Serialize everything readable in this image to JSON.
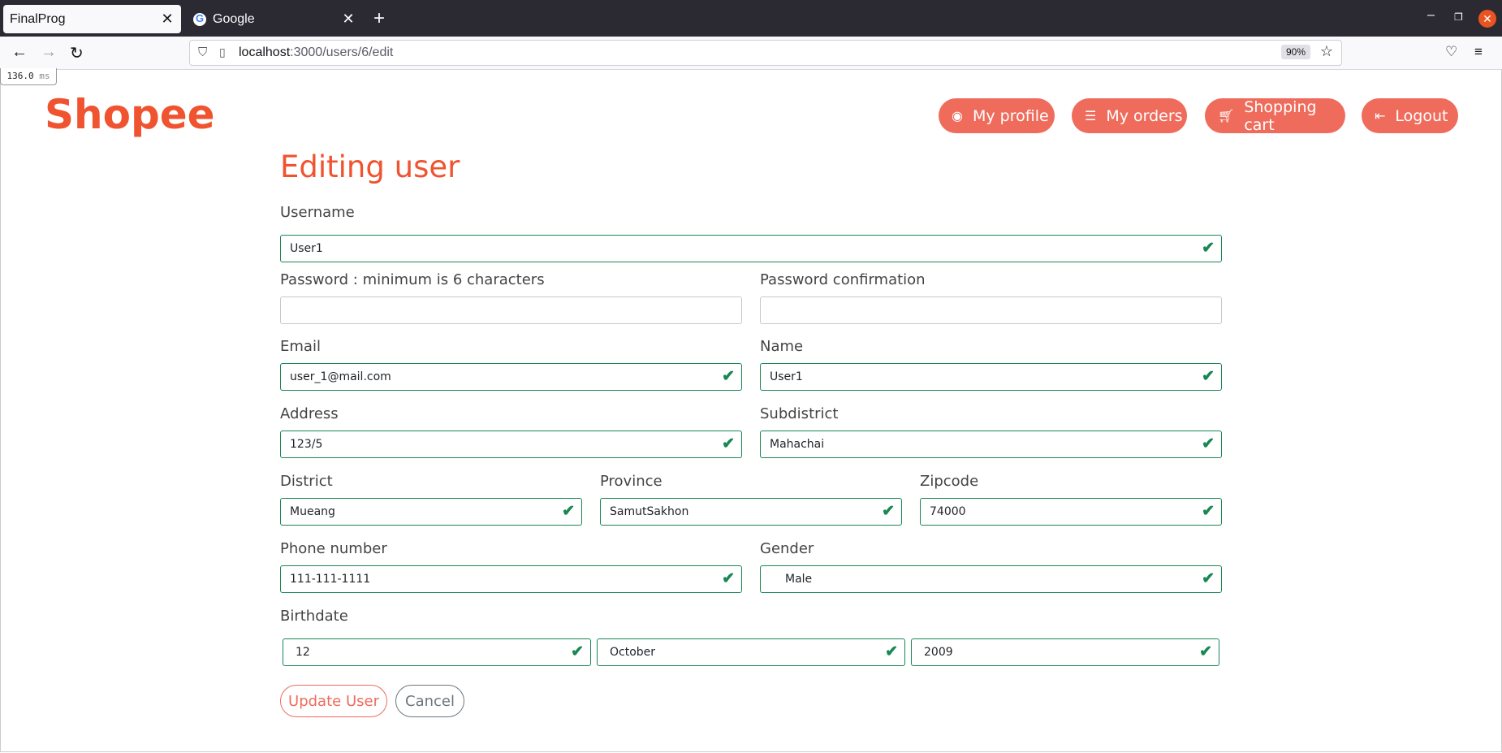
{
  "browser": {
    "tabs": [
      {
        "title": "FinalProg",
        "active": true
      },
      {
        "title": "Google",
        "active": false
      }
    ],
    "url_host": "localhost",
    "url_path": ":3000/users/6/edit",
    "zoom": "90%",
    "timing_value": "136.0",
    "timing_unit": "ms"
  },
  "header": {
    "brand": "Shopee",
    "nav": {
      "profile": "My profile",
      "orders": "My orders",
      "cart": "Shopping cart",
      "logout": "Logout"
    }
  },
  "form": {
    "title": "Editing user",
    "username_label": "Username",
    "username": "User1",
    "password_label": "Password : minimum is 6 characters",
    "password": "",
    "password_confirmation_label": "Password confirmation",
    "password_confirmation": "",
    "email_label": "Email",
    "email": "user_1@mail.com",
    "name_label": "Name",
    "name": "User1",
    "address_label": "Address",
    "address": "123/5",
    "subdistrict_label": "Subdistrict",
    "subdistrict": "Mahachai",
    "district_label": "District",
    "district": "Mueang",
    "province_label": "Province",
    "province": "SamutSakhon",
    "zipcode_label": "Zipcode",
    "zipcode": "74000",
    "phone_label": "Phone number",
    "phone": "111-111-1111",
    "gender_label": "Gender",
    "gender": "Male",
    "birthdate_label": "Birthdate",
    "birth_day": "12",
    "birth_month": "October",
    "birth_year": "2009",
    "update_button": "Update User",
    "cancel_button": "Cancel"
  },
  "colors": {
    "brand": "#f0532f",
    "nav_pill": "#ef6c5c",
    "valid": "#198754"
  }
}
